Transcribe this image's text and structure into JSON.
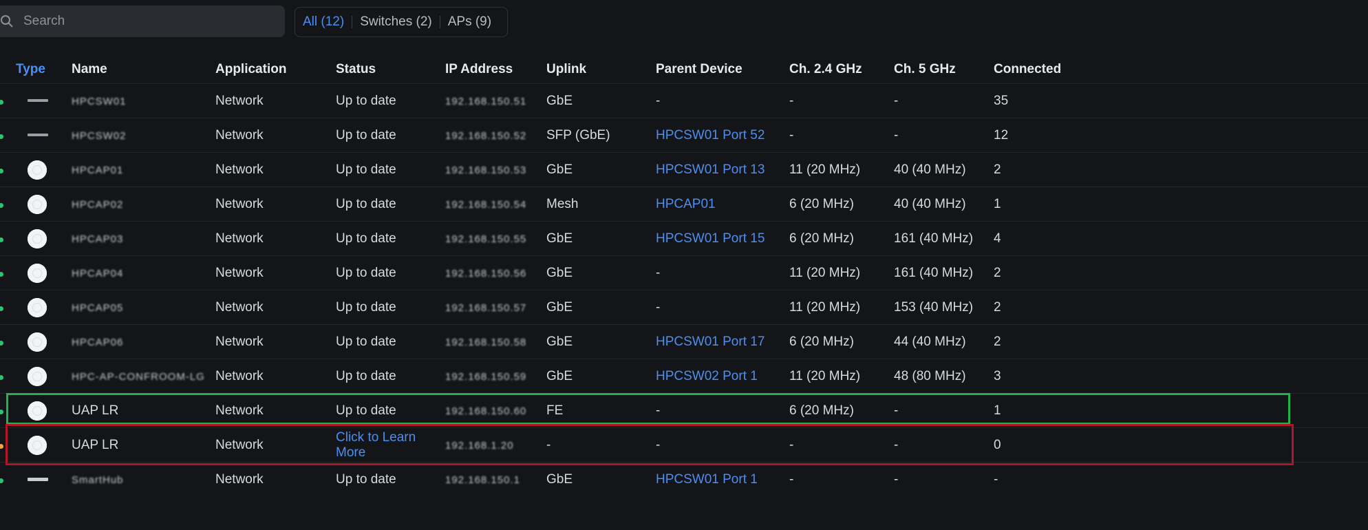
{
  "search": {
    "placeholder": "Search"
  },
  "filters": [
    {
      "label": "All (12)",
      "active": true
    },
    {
      "label": "Switches (2)",
      "active": false
    },
    {
      "label": "APs (9)",
      "active": false
    }
  ],
  "columns": [
    "Type",
    "Name",
    "Application",
    "Status",
    "IP Address",
    "Uplink",
    "Parent Device",
    "Ch. 2.4 GHz",
    "Ch. 5 GHz",
    "Connected"
  ],
  "rows": [
    {
      "type": "switch",
      "dot": "green",
      "name": "HPCSW01",
      "app": "Network",
      "status": "Up to date",
      "ip": "192.168.150.51",
      "uplink": "GbE",
      "parent": "-",
      "ch24": "-",
      "ch5": "-",
      "connected": "35"
    },
    {
      "type": "switch",
      "dot": "green",
      "name": "HPCSW02",
      "app": "Network",
      "status": "Up to date",
      "ip": "192.168.150.52",
      "uplink": "SFP (GbE)",
      "parent": "HPCSW01 Port 52",
      "ch24": "-",
      "ch5": "-",
      "connected": "12"
    },
    {
      "type": "ap",
      "dot": "green",
      "name": "HPCAP01",
      "app": "Network",
      "status": "Up to date",
      "ip": "192.168.150.53",
      "uplink": "GbE",
      "parent": "HPCSW01 Port 13",
      "ch24": "11 (20 MHz)",
      "ch5": "40 (40 MHz)",
      "connected": "2"
    },
    {
      "type": "ap",
      "dot": "green",
      "name": "HPCAP02",
      "app": "Network",
      "status": "Up to date",
      "ip": "192.168.150.54",
      "uplink": "Mesh",
      "parent": "HPCAP01",
      "ch24": "6 (20 MHz)",
      "ch5": "40 (40 MHz)",
      "connected": "1"
    },
    {
      "type": "ap",
      "dot": "green",
      "name": "HPCAP03",
      "app": "Network",
      "status": "Up to date",
      "ip": "192.168.150.55",
      "uplink": "GbE",
      "parent": "HPCSW01 Port 15",
      "ch24": "6 (20 MHz)",
      "ch5": "161 (40 MHz)",
      "connected": "4"
    },
    {
      "type": "ap",
      "dot": "green",
      "name": "HPCAP04",
      "app": "Network",
      "status": "Up to date",
      "ip": "192.168.150.56",
      "uplink": "GbE",
      "parent": "-",
      "ch24": "11 (20 MHz)",
      "ch5": "161 (40 MHz)",
      "connected": "2"
    },
    {
      "type": "ap",
      "dot": "green",
      "name": "HPCAP05",
      "app": "Network",
      "status": "Up to date",
      "ip": "192.168.150.57",
      "uplink": "GbE",
      "parent": "-",
      "ch24": "11 (20 MHz)",
      "ch5": "153 (40 MHz)",
      "connected": "2"
    },
    {
      "type": "ap",
      "dot": "green",
      "name": "HPCAP06",
      "app": "Network",
      "status": "Up to date",
      "ip": "192.168.150.58",
      "uplink": "GbE",
      "parent": "HPCSW01 Port 17",
      "ch24": "6 (20 MHz)",
      "ch5": "44 (40 MHz)",
      "connected": "2"
    },
    {
      "type": "ap",
      "dot": "green",
      "name": "HPC-AP-CONFROOM-LG",
      "app": "Network",
      "status": "Up to date",
      "ip": "192.168.150.59",
      "uplink": "GbE",
      "parent": "HPCSW02 Port 1",
      "ch24": "11 (20 MHz)",
      "ch5": "48 (80 MHz)",
      "connected": "3"
    },
    {
      "type": "ap",
      "dot": "green",
      "name": "UAP LR",
      "app": "Network",
      "status": "Up to date",
      "ip": "192.168.150.60",
      "uplink": "FE",
      "parent": "-",
      "ch24": "6 (20 MHz)",
      "ch5": "-",
      "connected": "1"
    },
    {
      "type": "ap",
      "dot": "orange",
      "name": "UAP LR",
      "app": "Network",
      "status": "Click to Learn More",
      "ip": "192.168.1.20",
      "uplink": "-",
      "parent": "-",
      "ch24": "-",
      "ch5": "-",
      "connected": "0"
    },
    {
      "type": "gateway",
      "dot": "green",
      "name": "SmartHub",
      "app": "Network",
      "status": "Up to date",
      "ip": "192.168.150.1",
      "uplink": "GbE",
      "parent": "HPCSW01 Port 1",
      "ch24": "-",
      "ch5": "-",
      "connected": "-"
    }
  ]
}
